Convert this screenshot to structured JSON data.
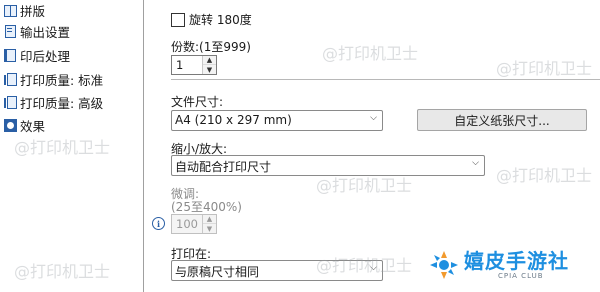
{
  "sidebar": {
    "items": [
      {
        "label": "拼版",
        "icon": "booklet-icon"
      },
      {
        "label": "输出设置",
        "icon": "output-settings-icon"
      },
      {
        "label": "印后处理",
        "icon": "finishing-icon"
      },
      {
        "label": "打印质量: 标准",
        "icon": "print-quality-icon"
      },
      {
        "label": "打印质量: 高级",
        "icon": "print-quality-icon"
      },
      {
        "label": "效果",
        "icon": "effects-icon"
      }
    ]
  },
  "rotate": {
    "label": "旋转 180度",
    "checked": false
  },
  "copies": {
    "label": "份数:(1至999)",
    "value": "1"
  },
  "paper_size": {
    "label": "文件尺寸:",
    "value": "A4 (210 x 297 mm)",
    "custom_button": "自定义纸张尺寸..."
  },
  "scale": {
    "label": "缩小/放大:",
    "value": "自动配合打印尺寸"
  },
  "fine_tune": {
    "label": "微调:",
    "range": "(25至400%)",
    "value": "100"
  },
  "print_on": {
    "label": "打印在:",
    "value": "与原稿尺寸相同"
  },
  "watermark": {
    "text": "@打印机卫士"
  },
  "logo": {
    "main": "嬉皮手游社",
    "sub": "CPIA CLUB"
  },
  "colors": {
    "accent": "#2a5fa5",
    "logo": "#1e8fe0"
  }
}
